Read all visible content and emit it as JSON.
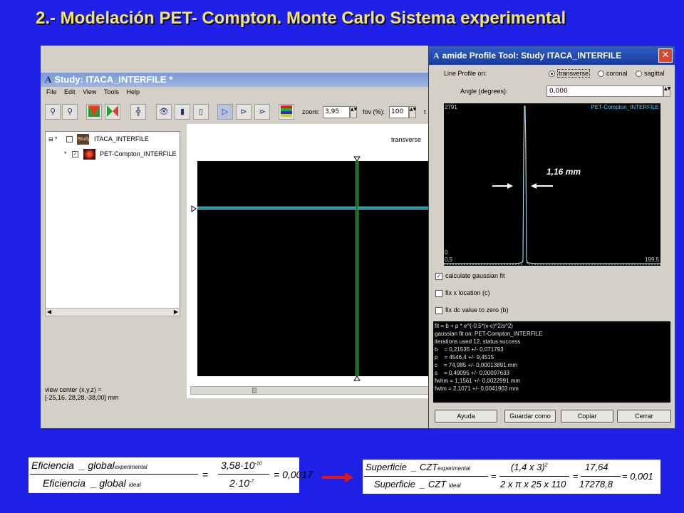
{
  "slide_title": "2.- Modelación PET- Compton. Monte Carlo Sistema experimental",
  "study_window": {
    "title": "Study: ITACA_INTERFILE *",
    "menu": [
      "File",
      "Edit",
      "View",
      "Tools",
      "Help"
    ],
    "zoom_label": "zoom:",
    "zoom_value": "3,95",
    "fov_label": "fov (%):",
    "fov_value": "100",
    "trailing_label": "t",
    "tree_items": [
      {
        "marker": "*",
        "thumb_label": "Study",
        "label": "ITACA_INTERFILE",
        "checked": false
      },
      {
        "marker": "*",
        "thumb_label": "",
        "label": "PET-Compton_INTERFILE",
        "checked": true
      }
    ],
    "view_label": "transverse",
    "view_center_line1": "view center (x,y,z) =",
    "view_center_line2": "[-25,16, 28,28,-38,00] mm"
  },
  "profile_tool": {
    "title": "amide Profile Tool: Study ITACA_INTERFILE",
    "line_profile_label": "Line Profile on:",
    "orientations": [
      {
        "label": "transverse",
        "selected": true
      },
      {
        "label": "coronal",
        "selected": false
      },
      {
        "label": "sagittal",
        "selected": false
      }
    ],
    "angle_label": "Angle (degrees):",
    "angle_value": "0,000",
    "plot": {
      "y_max_label": "2791",
      "y_min_label": "0",
      "x_min_label": "0,5",
      "x_max_label": "199,5",
      "series_name": "PET-Compton_INTERFILE"
    },
    "annotation": "1,16 mm",
    "options": [
      {
        "label": "calculate gaussian fit",
        "checked": true
      },
      {
        "label": "fix x location (c)",
        "checked": false
      },
      {
        "label": "fix dc value to zero (b)",
        "checked": false
      }
    ],
    "fit_output": [
      "fit = b + p * e^(-0.5*(x-c)^2/s^2)",
      "",
      "gaussian fit on: PET-Compton_INTERFILE",
      "iterations used 12, status success",
      "b    = 0,21535 +/- 0,071793",
      "p    = 4546,4 +/- 9,4515",
      "c    = 74,985 +/- 0,00013891 mm",
      "s    = 0,49095 +/- 0,00097633",
      "fwhm = 1,1561 +/- 0,0022991 mm",
      "fwtm = 2,1071 +/- 0,0041903 mm"
    ],
    "buttons": [
      "Ayuda",
      "Guardar como",
      "Copiar",
      "Cerrar"
    ]
  },
  "equation_left": {
    "num_word": "Eficiencia",
    "num_rest": "_ global",
    "num_sub": "experimental",
    "den_word": "Eficiencia",
    "den_rest": "_ global",
    "den_sub": "ideal",
    "val_num": "3,58·10",
    "val_num_exp": "-10",
    "val_den": "2·10",
    "val_den_exp": "-7",
    "result": "= 0,0017"
  },
  "equation_right": {
    "num_word": "Superficie",
    "num_rest": "_ CZT",
    "num_sub": "experimental",
    "den_word": "Superficie",
    "den_rest": "_ CZT",
    "den_sub": "ideal",
    "frac2_num": "(1,4 x 3)",
    "frac2_num_exp": "2",
    "frac2_den": "2 x π x 25 x 110",
    "frac3_num": "17,64",
    "frac3_den": "17278,8",
    "result": "= 0,001"
  }
}
